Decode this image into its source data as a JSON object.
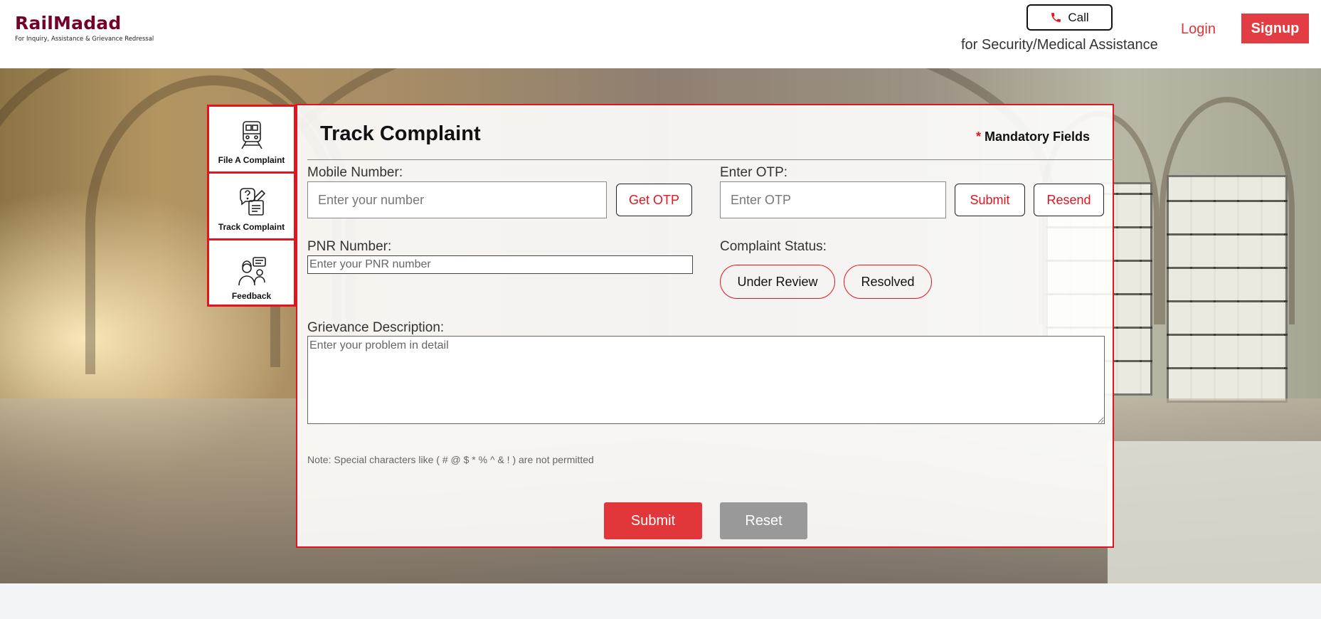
{
  "header": {
    "logo_title": "RailMadad",
    "logo_tagline": "For Inquiry, Assistance & Grievance Redressal",
    "call_label": "Call",
    "call_note": "for Security/Medical Assistance",
    "login_label": "Login",
    "signup_label": "Signup",
    "brand_color": "#75002b",
    "accent_color": "#e13d43"
  },
  "sidebar": {
    "items": [
      {
        "label": "File A Complaint",
        "icon": "train-icon"
      },
      {
        "label": "Track Complaint",
        "icon": "complaint-question-icon"
      },
      {
        "label": "Feedback",
        "icon": "feedback-person-icon"
      }
    ]
  },
  "form": {
    "title": "Track Complaint",
    "mandatory_star": "*",
    "mandatory_label": "Mandatory Fields",
    "mobile_label": "Mobile Number:",
    "mobile_placeholder": "Enter your number",
    "mobile_value": "",
    "get_otp_label": "Get OTP",
    "otp_label": "Enter OTP:",
    "otp_placeholder": "Enter OTP",
    "otp_value": "",
    "otp_submit_label": "Submit",
    "otp_resend_label": "Resend",
    "pnr_label": "PNR Number:",
    "pnr_placeholder": "Enter your PNR number",
    "pnr_value": "",
    "status_label": "Complaint Status:",
    "status_options": [
      "Under Review",
      "Resolved"
    ],
    "grievance_label": "Grievance Description:",
    "grievance_placeholder": "Enter your problem in detail",
    "grievance_value": "",
    "note": "Note: Special characters like ( # @ $ * % ^ & ! ) are not permitted",
    "submit_label": "Submit",
    "reset_label": "Reset"
  }
}
